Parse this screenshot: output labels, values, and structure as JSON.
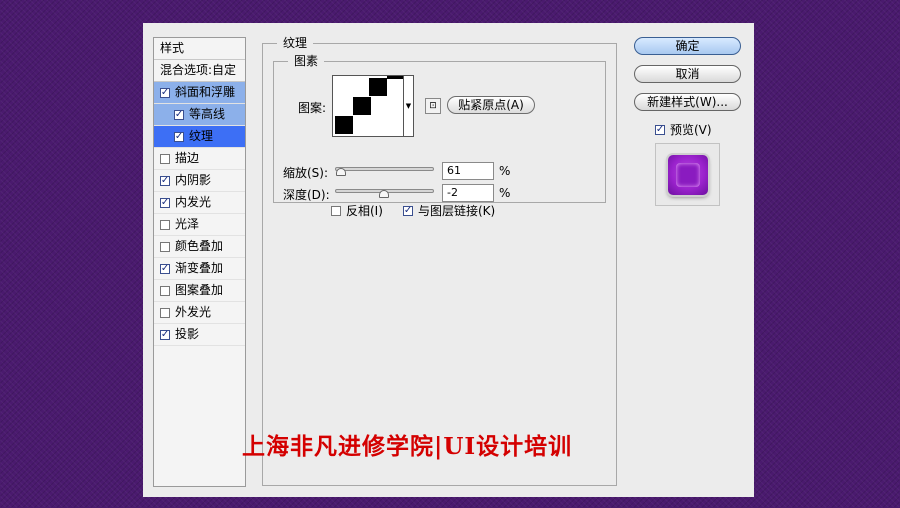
{
  "styles_panel": {
    "header": "样式",
    "blend_options": "混合选项:自定",
    "items": [
      {
        "label": "斜面和浮雕",
        "checked": true
      },
      {
        "label": "等高线",
        "checked": true
      },
      {
        "label": "纹理",
        "checked": true
      },
      {
        "label": "描边",
        "checked": false
      },
      {
        "label": "内阴影",
        "checked": true
      },
      {
        "label": "内发光",
        "checked": true
      },
      {
        "label": "光泽",
        "checked": false
      },
      {
        "label": "颜色叠加",
        "checked": false
      },
      {
        "label": "渐变叠加",
        "checked": true
      },
      {
        "label": "图案叠加",
        "checked": false
      },
      {
        "label": "外发光",
        "checked": false
      },
      {
        "label": "投影",
        "checked": true
      }
    ]
  },
  "texture": {
    "group_title": "纹理",
    "pixel_group_title": "图素",
    "pattern_label": "图案:",
    "snap_button": "贴紧原点(A)",
    "scale_label": "缩放(S):",
    "scale_value": "61",
    "scale_unit": "%",
    "scale_level": 61,
    "depth_label": "深度(D):",
    "depth_value": "-2",
    "depth_unit": "%",
    "depth_level": -2,
    "invert_label": "反相(I)",
    "invert_checked": false,
    "link_label": "与图层链接(K)",
    "link_checked": true
  },
  "buttons": {
    "ok": "确定",
    "cancel": "取消",
    "new_style": "新建样式(W)..."
  },
  "preview": {
    "label": "预览(V)",
    "checked": true
  },
  "watermark": "上海非凡进修学院|UI设计培训",
  "icons": {
    "checkbox_checked": "checkmark-icon",
    "dropdown": "triangle-down-icon",
    "new_preset": "new-preset-icon"
  }
}
